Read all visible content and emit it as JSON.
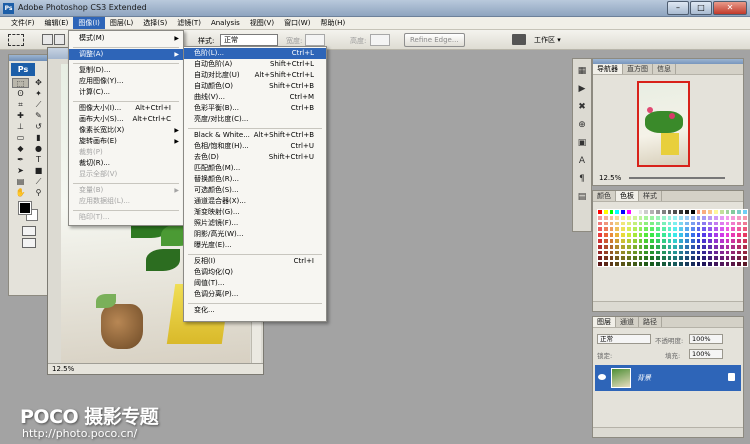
{
  "window": {
    "title": "Adobe Photoshop CS3 Extended",
    "min": "–",
    "max": "□",
    "close": "✕"
  },
  "menubar": [
    "文件(F)",
    "编辑(E)",
    "图像(I)",
    "图层(L)",
    "选择(S)",
    "滤镜(T)",
    "Analysis",
    "视图(V)",
    "窗口(W)",
    "帮助(H)"
  ],
  "active_menu_index": 2,
  "options_bar": {
    "feather_label": "羽化",
    "feather_value": "0 px",
    "style_label": "样式:",
    "style_value": "正常",
    "width_label": "宽度:",
    "height_label": "高度:",
    "refine_edge": "Refine Edge...",
    "workspace": "工作区 ▾"
  },
  "image_menu": [
    {
      "label": "模式(M)",
      "submenu": true
    },
    {
      "sep": true
    },
    {
      "label": "调整(A)",
      "submenu": true,
      "highlight": true
    },
    {
      "sep": true
    },
    {
      "label": "复制(D)..."
    },
    {
      "label": "应用图像(Y)..."
    },
    {
      "label": "计算(C)..."
    },
    {
      "sep": true
    },
    {
      "label": "图像大小(I)...",
      "shortcut": "Alt+Ctrl+I"
    },
    {
      "label": "画布大小(S)...",
      "shortcut": "Alt+Ctrl+C"
    },
    {
      "label": "像素长宽比(X)",
      "submenu": true
    },
    {
      "label": "旋转画布(E)",
      "submenu": true
    },
    {
      "label": "裁剪(P)",
      "disabled": true
    },
    {
      "label": "裁切(R)..."
    },
    {
      "label": "显示全部(V)",
      "disabled": true
    },
    {
      "sep": true
    },
    {
      "label": "变量(B)",
      "submenu": true,
      "disabled": true
    },
    {
      "label": "应用数据组(L)...",
      "disabled": true
    },
    {
      "sep": true
    },
    {
      "label": "陷印(T)...",
      "disabled": true
    }
  ],
  "adjust_menu": [
    {
      "label": "色阶(L)...",
      "shortcut": "Ctrl+L",
      "highlight": true
    },
    {
      "label": "自动色阶(A)",
      "shortcut": "Shift+Ctrl+L"
    },
    {
      "label": "自动对比度(U)",
      "shortcut": "Alt+Shift+Ctrl+L"
    },
    {
      "label": "自动颜色(O)",
      "shortcut": "Shift+Ctrl+B"
    },
    {
      "label": "曲线(V)...",
      "shortcut": "Ctrl+M"
    },
    {
      "label": "色彩平衡(B)...",
      "shortcut": "Ctrl+B"
    },
    {
      "label": "亮度/对比度(C)..."
    },
    {
      "sep": true
    },
    {
      "label": "Black & White...",
      "shortcut": "Alt+Shift+Ctrl+B"
    },
    {
      "label": "色相/饱和度(H)...",
      "shortcut": "Ctrl+U"
    },
    {
      "label": "去色(D)",
      "shortcut": "Shift+Ctrl+U"
    },
    {
      "label": "匹配颜色(M)..."
    },
    {
      "label": "替换颜色(R)..."
    },
    {
      "label": "可选颜色(S)..."
    },
    {
      "label": "通道混合器(X)..."
    },
    {
      "label": "渐变映射(G)..."
    },
    {
      "label": "照片滤镜(F)..."
    },
    {
      "label": "阴影/高光(W)..."
    },
    {
      "label": "曝光度(E)..."
    },
    {
      "sep": true
    },
    {
      "label": "反相(I)",
      "shortcut": "Ctrl+I"
    },
    {
      "label": "色调均化(Q)"
    },
    {
      "label": "阈值(T)..."
    },
    {
      "label": "色调分离(P)..."
    },
    {
      "sep": true
    },
    {
      "label": "变化..."
    }
  ],
  "document": {
    "zoom": "12.5%"
  },
  "navigator_panel": {
    "tabs": [
      "导航器",
      "直方图",
      "信息"
    ],
    "zoom": "12.5%"
  },
  "swatches_panel": {
    "tabs": [
      "颜色",
      "色板",
      "样式"
    ],
    "active_tab": 1
  },
  "layers_panel": {
    "tabs": [
      "图层",
      "通道",
      "路径"
    ],
    "blend_mode": "正常",
    "opacity_label": "不透明度:",
    "opacity_value": "100%",
    "lock_label": "锁定:",
    "fill_label": "填充:",
    "fill_value": "100%",
    "layer_name": "背景"
  },
  "watermark": {
    "brand": "POCO 摄影专题",
    "url": "http://photo.poco.cn/"
  },
  "colors": {
    "menu_highlight": "#2e65b8",
    "foreground": "#000000",
    "background": "#ffffff"
  }
}
